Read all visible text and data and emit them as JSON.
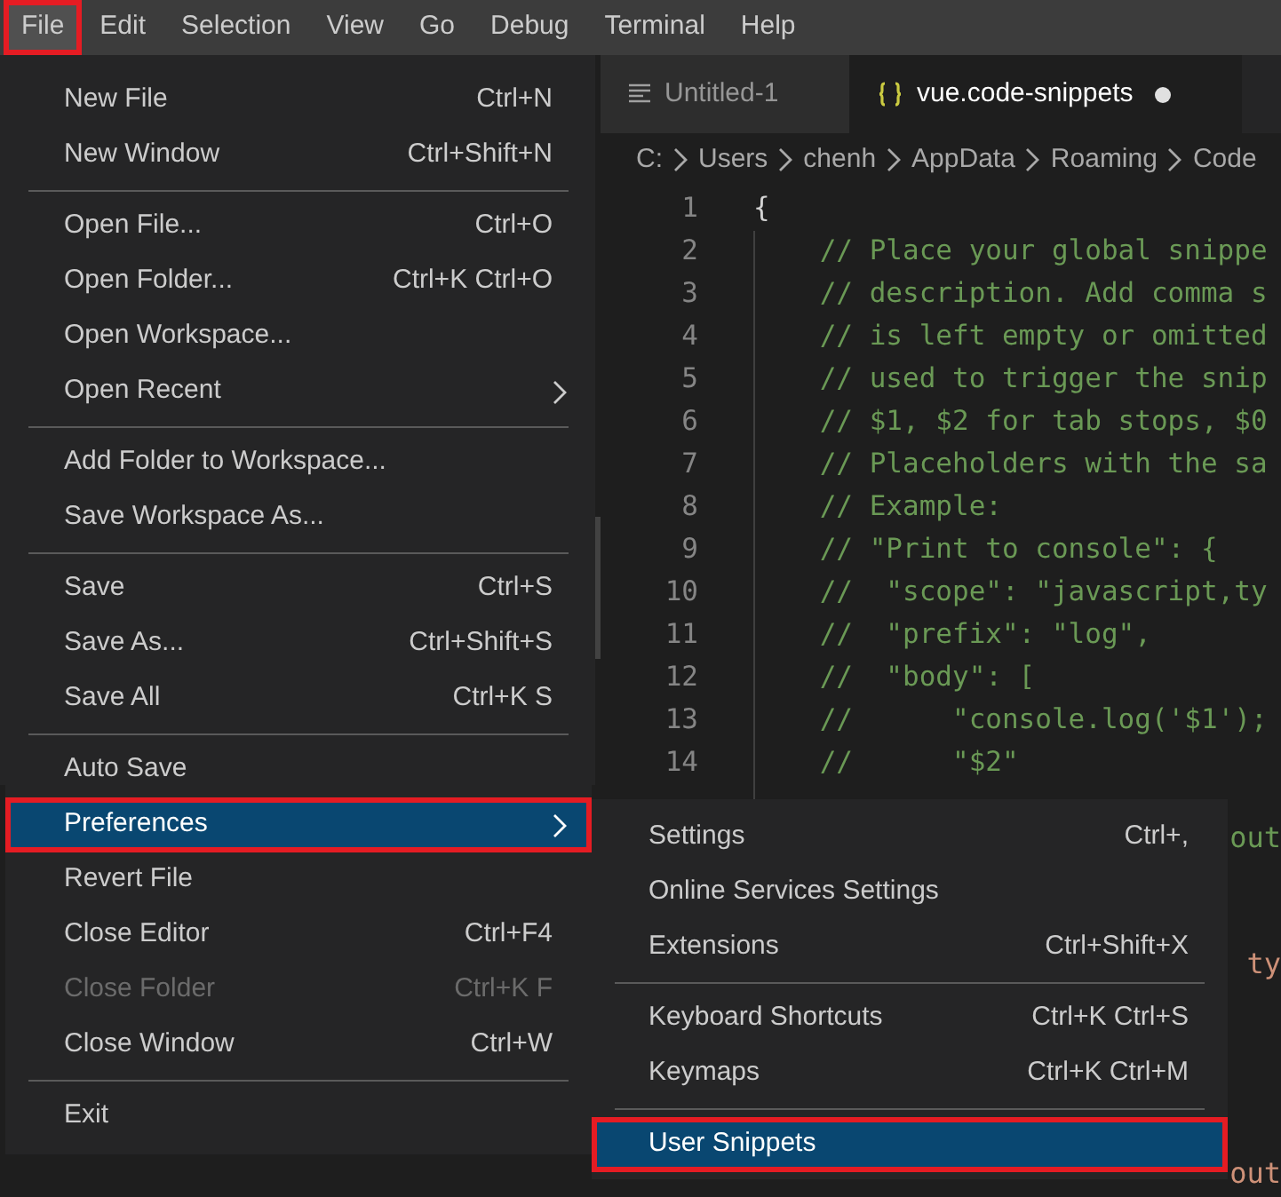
{
  "menubar": [
    {
      "label": "File",
      "selected": true,
      "outlined": true
    },
    {
      "label": "Edit",
      "selected": false,
      "outlined": false
    },
    {
      "label": "Selection",
      "selected": false,
      "outlined": false
    },
    {
      "label": "View",
      "selected": false,
      "outlined": false
    },
    {
      "label": "Go",
      "selected": false,
      "outlined": false
    },
    {
      "label": "Debug",
      "selected": false,
      "outlined": false
    },
    {
      "label": "Terminal",
      "selected": false,
      "outlined": false
    },
    {
      "label": "Help",
      "selected": false,
      "outlined": false
    }
  ],
  "tabs": [
    {
      "label": "Untitled-1",
      "kind": "text",
      "selected": false,
      "dirty": false
    },
    {
      "label": "vue.code-snippets",
      "kind": "json",
      "selected": true,
      "dirty": true
    }
  ],
  "breadcrumb": [
    "C:",
    "Users",
    "chenh",
    "AppData",
    "Roaming",
    "Code"
  ],
  "editor": {
    "lines": [
      {
        "number": "1",
        "text": "{",
        "kind": "plain"
      },
      {
        "number": "2",
        "text": "    // Place your global snippe",
        "kind": "comment"
      },
      {
        "number": "3",
        "text": "    // description. Add comma s",
        "kind": "comment"
      },
      {
        "number": "4",
        "text": "    // is left empty or omitted",
        "kind": "comment"
      },
      {
        "number": "5",
        "text": "    // used to trigger the snip",
        "kind": "comment"
      },
      {
        "number": "6",
        "text": "    // $1, $2 for tab stops, $0",
        "kind": "comment"
      },
      {
        "number": "7",
        "text": "    // Placeholders with the sa",
        "kind": "comment"
      },
      {
        "number": "8",
        "text": "    // Example:",
        "kind": "comment"
      },
      {
        "number": "9",
        "text": "    // \"Print to console\": {",
        "kind": "comment"
      },
      {
        "number": "10",
        "text": "    //  \"scope\": \"javascript,ty",
        "kind": "comment"
      },
      {
        "number": "11",
        "text": "    //  \"prefix\": \"log\",",
        "kind": "comment"
      },
      {
        "number": "12",
        "text": "    //  \"body\": [",
        "kind": "comment"
      },
      {
        "number": "13",
        "text": "    //      \"console.log('$1');",
        "kind": "comment"
      },
      {
        "number": "14",
        "text": "    //      \"$2\"",
        "kind": "comment"
      }
    ],
    "fragments": [
      {
        "text": "out",
        "kind": "comment"
      },
      {
        "text": "ty",
        "kind": "string"
      },
      {
        "text": "out",
        "kind": "string"
      }
    ]
  },
  "file_menu": [
    [
      {
        "label": "New File",
        "shortcut": "Ctrl+N"
      },
      {
        "label": "New Window",
        "shortcut": "Ctrl+Shift+N"
      }
    ],
    [
      {
        "label": "Open File...",
        "shortcut": "Ctrl+O"
      },
      {
        "label": "Open Folder...",
        "shortcut": "Ctrl+K Ctrl+O"
      },
      {
        "label": "Open Workspace..."
      },
      {
        "label": "Open Recent",
        "submenu": true
      }
    ],
    [
      {
        "label": "Add Folder to Workspace..."
      },
      {
        "label": "Save Workspace As..."
      }
    ],
    [
      {
        "label": "Save",
        "shortcut": "Ctrl+S"
      },
      {
        "label": "Save As...",
        "shortcut": "Ctrl+Shift+S"
      },
      {
        "label": "Save All",
        "shortcut": "Ctrl+K S"
      }
    ],
    [
      {
        "label": "Auto Save"
      },
      {
        "label": "Preferences",
        "submenu": true,
        "selected": true,
        "outlined": true
      },
      {
        "label": "Revert File"
      },
      {
        "label": "Close Editor",
        "shortcut": "Ctrl+F4"
      },
      {
        "label": "Close Folder",
        "shortcut": "Ctrl+K F",
        "disabled": true
      },
      {
        "label": "Close Window",
        "shortcut": "Ctrl+W"
      }
    ],
    [
      {
        "label": "Exit"
      }
    ]
  ],
  "preferences_menu": [
    [
      {
        "label": "Settings",
        "shortcut": "Ctrl+,"
      },
      {
        "label": "Online Services Settings"
      },
      {
        "label": "Extensions",
        "shortcut": "Ctrl+Shift+X"
      }
    ],
    [
      {
        "label": "Keyboard Shortcuts",
        "shortcut": "Ctrl+K Ctrl+S"
      },
      {
        "label": "Keymaps",
        "shortcut": "Ctrl+K Ctrl+M"
      }
    ],
    [
      {
        "label": "User Snippets",
        "selected": true,
        "outlined": true
      }
    ]
  ]
}
